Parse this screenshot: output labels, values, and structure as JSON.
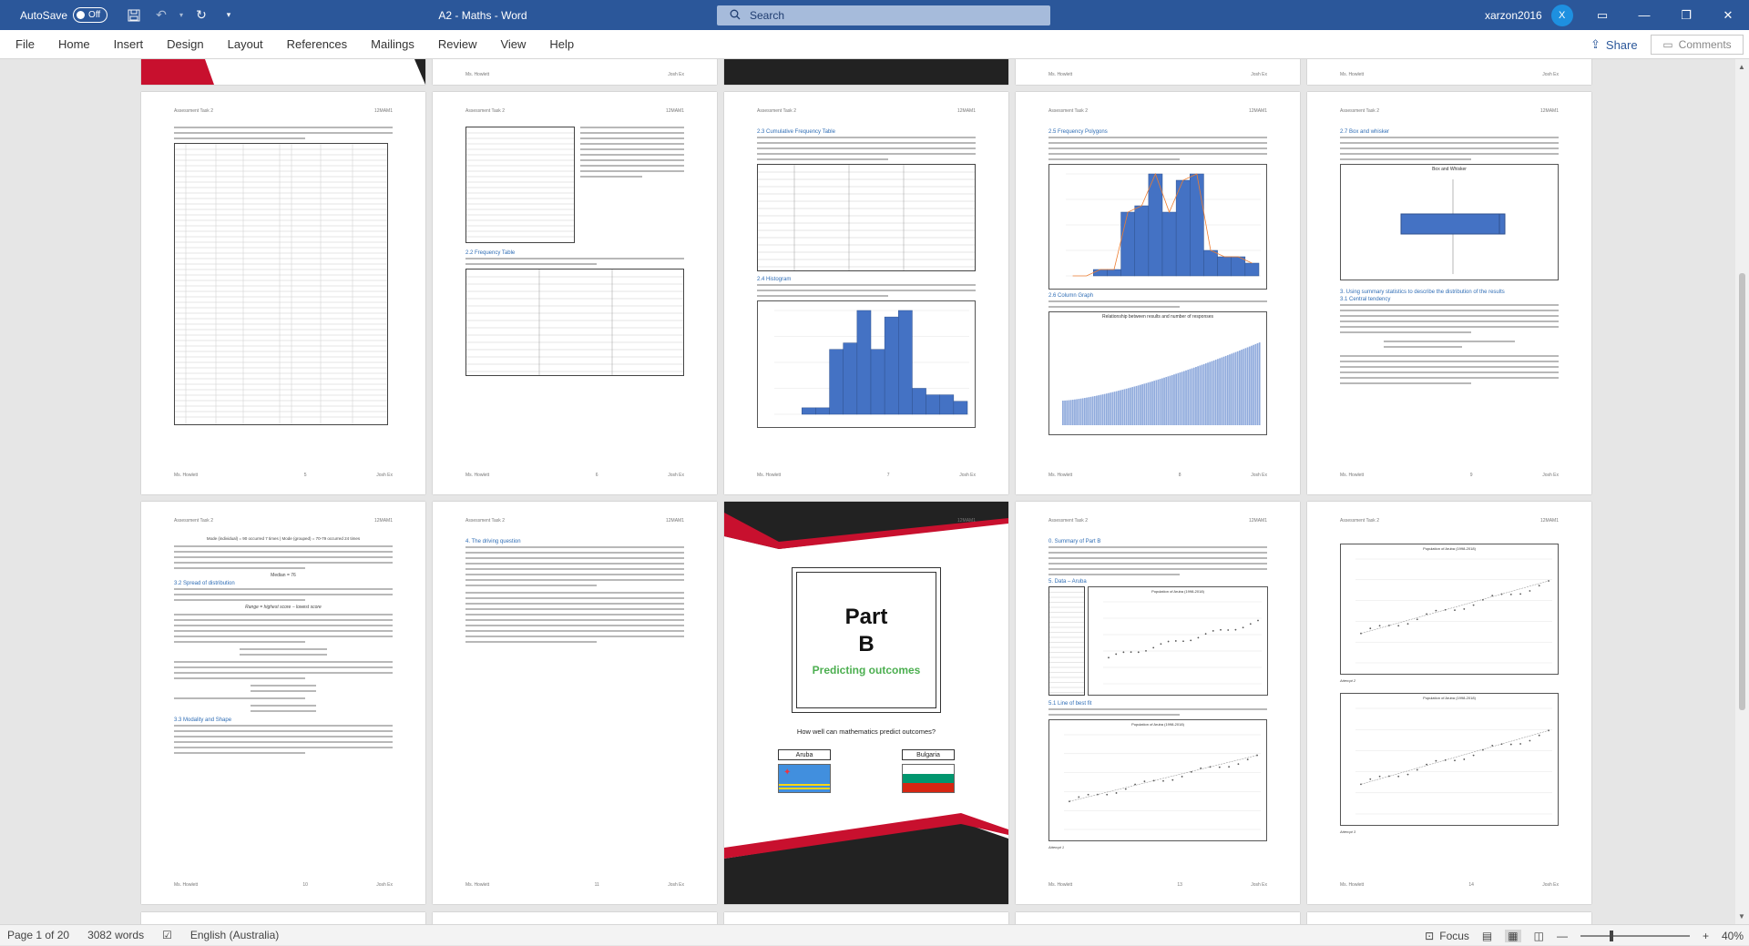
{
  "titlebar": {
    "autosave_label": "AutoSave",
    "autosave_state": "Off",
    "doc_title": "A2 - Maths  -  Word",
    "search_placeholder": "Search",
    "user_name": "xarzon2016",
    "user_initial": "X"
  },
  "ribbon": {
    "tabs": [
      "File",
      "Home",
      "Insert",
      "Design",
      "Layout",
      "References",
      "Mailings",
      "Review",
      "View",
      "Help"
    ],
    "share_label": "Share",
    "comments_label": "Comments"
  },
  "pages": {
    "header_left": "Assessment Task 2",
    "header_right": "12MAM1",
    "footer_left": "Ms. Howlett",
    "footer_right": "Josh Ex",
    "page_numbers": [
      "5",
      "6",
      "7",
      "8",
      "9",
      "10",
      "11",
      "",
      "13",
      "14"
    ],
    "p5_heading": "",
    "p6_heading": "2.2 Frequency Table",
    "p7_heading_a": "2.3 Cumulative Frequency Table",
    "p7_heading_b": "2.4 Histogram",
    "p8_heading_a": "2.5 Frequency Polygons",
    "p8_heading_b": "2.6 Column Graph",
    "p8_chart_title": "Relationship between results and number of responses",
    "p9_heading_a": "2.7 Box and whisker",
    "p9_heading_b": "3. Using summary statistics to describe the distribution of the results",
    "p9_heading_c": "3.1 Central tendency",
    "p9_chart_title": "Box and Whisker",
    "p10_mode": "Mode (individual) = 90 occurred 7 times  |  Mode (grouped) = 70-79 occurred 24 times",
    "p10_median": "Median = 76",
    "p10_heading_a": "3.2 Spread of distribution",
    "p10_range": "Range = highest score − lowest score",
    "p10_heading_b": "3.3 Modality and Shape",
    "p11_heading": "4. The driving question",
    "p13_heading_a": "0. Summary of Part B",
    "p13_heading_b": "5. Data – Aruba",
    "p13_heading_c": "5.1 Line of best fit",
    "p13_chart_title_a": "Population of Aruba (1998-2018)",
    "p13_chart_title_b": "Population of Aruba (1998-2018)",
    "p14_chart_title_a": "Population of Aruba (1998-2018)",
    "p14_chart_title_b": "Population of Aruba (1998-2018)",
    "p14_caption_a": "Attempt 2",
    "p14_caption_b": "Attempt 3",
    "p13_caption": "Attempt 1"
  },
  "cover": {
    "part": "Part",
    "letter": "B",
    "subtitle": "Predicting outcomes",
    "question": "How well can mathematics predict outcomes?",
    "country_a": "Aruba",
    "country_b": "Bulgaria",
    "colors": {
      "accent_red": "#c8102e",
      "dark": "#222222",
      "green": "#4caf50"
    }
  },
  "status": {
    "page_info": "Page 1 of 20",
    "word_count": "3082 words",
    "language": "English (Australia)",
    "focus_label": "Focus",
    "zoom": "40%"
  },
  "colors": {
    "titlebar": "#2b579a",
    "heading_blue": "#2f6db5",
    "bar_blue": "#4472c4"
  }
}
